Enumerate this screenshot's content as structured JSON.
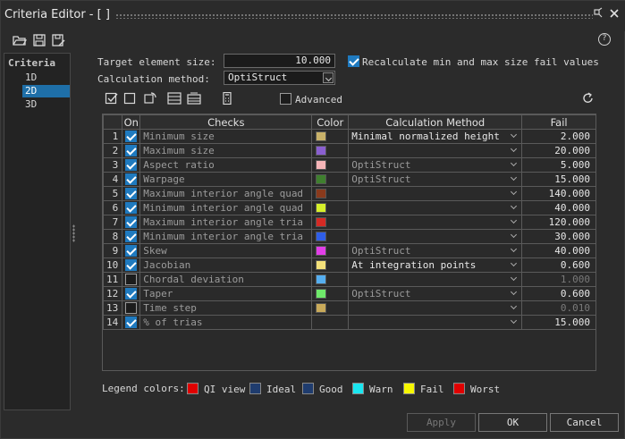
{
  "window": {
    "title": "Criteria Editor - [ ]"
  },
  "toolbar": {
    "icons": [
      "open-folder-icon",
      "save-icon",
      "save-as-icon"
    ],
    "help": "?"
  },
  "left_panel": {
    "header": "Criteria",
    "items": [
      {
        "label": "1D"
      },
      {
        "label": "2D",
        "selected": true
      },
      {
        "label": "3D"
      }
    ]
  },
  "settings": {
    "target_label": "Target element size:",
    "target_value": "10.000",
    "recalc_label": "Recalculate min and max size fail values",
    "recalc_checked": true,
    "calc_label": "Calculation method:",
    "calc_value": "OptiStruct",
    "advanced_label": "Advanced",
    "advanced_checked": false
  },
  "table": {
    "headers": {
      "on": "On",
      "checks": "Checks",
      "color": "Color",
      "method": "Calculation Method",
      "fail": "Fail"
    },
    "rows": [
      {
        "num": "1",
        "on": true,
        "check": "Minimum size",
        "color": "#c9b26a",
        "method": "Minimal normalized height",
        "fail": "2.000"
      },
      {
        "num": "2",
        "on": true,
        "check": "Maximum size",
        "color": "#8a5fd0",
        "method": "",
        "fail": "20.000"
      },
      {
        "num": "3",
        "on": true,
        "check": "Aspect ratio",
        "color": "#f5b5b8",
        "method": "OptiStruct",
        "fail": "5.000"
      },
      {
        "num": "4",
        "on": true,
        "check": "Warpage",
        "color": "#3f7f2e",
        "method": "OptiStruct",
        "fail": "15.000"
      },
      {
        "num": "5",
        "on": true,
        "check": "Maximum interior angle quad",
        "color": "#8a3a1c",
        "method": "",
        "fail": "140.000"
      },
      {
        "num": "6",
        "on": true,
        "check": "Minimum interior angle quad",
        "color": "#d6ef2a",
        "method": "",
        "fail": "40.000"
      },
      {
        "num": "7",
        "on": true,
        "check": "Maximum interior angle tria",
        "color": "#d52a24",
        "method": "",
        "fail": "120.000"
      },
      {
        "num": "8",
        "on": true,
        "check": "Minimum interior angle tria",
        "color": "#2f5ee8",
        "method": "",
        "fail": "30.000"
      },
      {
        "num": "9",
        "on": true,
        "check": "Skew",
        "color": "#e23ee8",
        "method": "OptiStruct",
        "fail": "40.000"
      },
      {
        "num": "10",
        "on": true,
        "check": "Jacobian",
        "color": "#f3e07a",
        "method": "At integration points",
        "fail": "0.600"
      },
      {
        "num": "11",
        "on": false,
        "check": "Chordal deviation",
        "color": "#55aef0",
        "method": "",
        "fail": "1.000"
      },
      {
        "num": "12",
        "on": true,
        "check": "Taper",
        "color": "#6ee86a",
        "method": "OptiStruct",
        "fail": "0.600"
      },
      {
        "num": "13",
        "on": false,
        "check": "Time step",
        "color": "#c9aa5a",
        "method": "",
        "fail": "0.010"
      },
      {
        "num": "14",
        "on": true,
        "check": "% of trias",
        "color": "",
        "method": "",
        "fail": "15.000"
      }
    ]
  },
  "legend": {
    "label": "Legend colors:",
    "items": [
      {
        "label": "QI view",
        "color": "#e00000"
      },
      {
        "label": "Ideal",
        "color": "#1f3c6e"
      },
      {
        "label": "Good",
        "color": "#1f3c6e"
      },
      {
        "label": "Warn",
        "color": "#1ae6f0"
      },
      {
        "label": "Fail",
        "color": "#f7f700"
      },
      {
        "label": "Worst",
        "color": "#e00000"
      }
    ]
  },
  "buttons": {
    "apply": "Apply",
    "ok": "OK",
    "cancel": "Cancel"
  }
}
